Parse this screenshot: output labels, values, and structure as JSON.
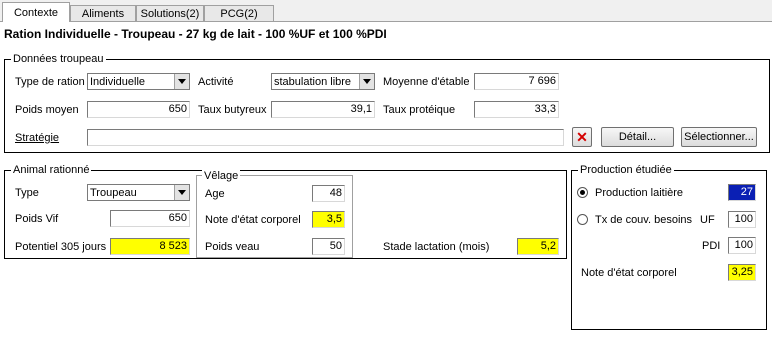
{
  "tabs": [
    "Contexte",
    "Aliments",
    "Solutions(2)",
    "PCG(2)"
  ],
  "title": "Ration Individuelle - Troupeau - 27 kg de lait - 100 %UF et 100 %PDI",
  "troupeau": {
    "legend": "Données troupeau",
    "type_ration_label": "Type de ration",
    "type_ration_value": "Individuelle",
    "activite_label": "Activité",
    "activite_value": "stabulation libre",
    "moyenne_label": "Moyenne d'étable",
    "moyenne_value": "7 696",
    "poids_moyen_label": "Poids moyen",
    "poids_moyen_value": "650",
    "taux_butyreux_label": "Taux butyreux",
    "taux_butyreux_value": "39,1",
    "taux_proteique_label": "Taux protéique",
    "taux_proteique_value": "33,3",
    "strategie_label": "Stratégie",
    "strategie_value": "",
    "detail_button": "Détail...",
    "selectionner_button": "Sélectionner..."
  },
  "animal": {
    "legend": "Animal rationné",
    "type_label": "Type",
    "type_value": "Troupeau",
    "poids_vif_label": "Poids Vif",
    "poids_vif_value": "650",
    "potentiel_label": "Potentiel 305 jours",
    "potentiel_value": "8 523",
    "stade_label": "Stade lactation (mois)",
    "stade_value": "5,2",
    "velage": {
      "legend": "Vêlage",
      "age_label": "Age",
      "age_value": "48",
      "note_label": "Note d'état corporel",
      "note_value": "3,5",
      "poids_veau_label": "Poids veau",
      "poids_veau_value": "50"
    }
  },
  "production": {
    "legend": "Production étudiée",
    "laitiere_label": "Production laitière",
    "laitiere_value": "27",
    "tx_label": "Tx de couv. besoins",
    "uf_label": "UF",
    "uf_value": "100",
    "pdi_label": "PDI",
    "pdi_value": "100",
    "note_label": "Note d'état corporel",
    "note_value": "3,25"
  },
  "colors": {
    "highlight": "#ffff00",
    "selected": "#0a1fb4",
    "delete": "#d40000"
  }
}
